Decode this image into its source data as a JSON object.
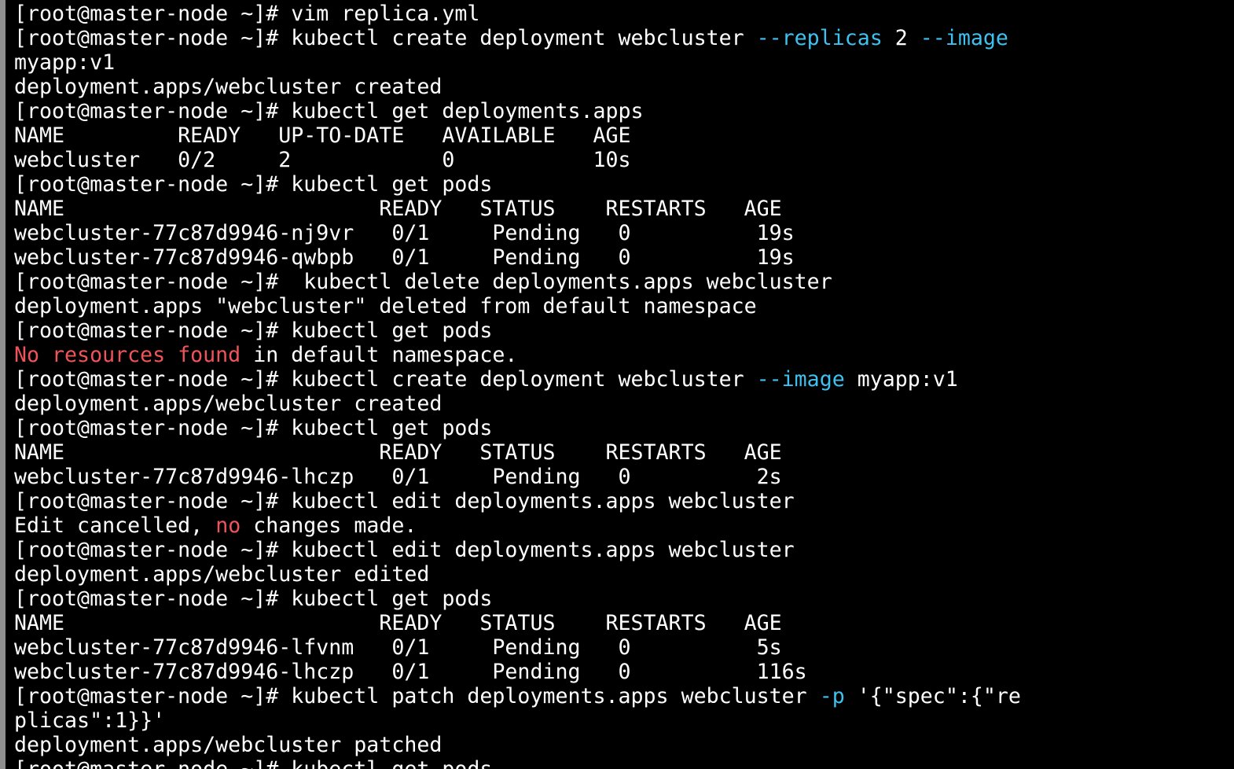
{
  "colors": {
    "background": "#000000",
    "text": "#ffffff",
    "option": "#3fc1f0",
    "error": "#f0545b"
  },
  "terminal": {
    "lines": [
      [
        {
          "t": "[root@master-node ~]# vim replica.yml"
        }
      ],
      [
        {
          "t": "[root@master-node ~]# kubectl create deployment webcluster "
        },
        {
          "t": "--replicas",
          "c": "cyan"
        },
        {
          "t": " 2 "
        },
        {
          "t": "--image",
          "c": "cyan"
        }
      ],
      [
        {
          "t": "myapp:v1"
        }
      ],
      [
        {
          "t": "deployment.apps/webcluster created"
        }
      ],
      [
        {
          "t": "[root@master-node ~]# kubectl get deployments.apps"
        }
      ],
      [
        {
          "t": "NAME         READY   UP-TO-DATE   AVAILABLE   AGE"
        }
      ],
      [
        {
          "t": "webcluster   0/2     2            0           10s"
        }
      ],
      [
        {
          "t": "[root@master-node ~]# kubectl get pods"
        }
      ],
      [
        {
          "t": "NAME                         READY   STATUS    RESTARTS   AGE"
        }
      ],
      [
        {
          "t": "webcluster-77c87d9946-nj9vr   0/1     Pending   0          19s"
        }
      ],
      [
        {
          "t": "webcluster-77c87d9946-qwbpb   0/1     Pending   0          19s"
        }
      ],
      [
        {
          "t": "[root@master-node ~]#  kubectl delete deployments.apps webcluster"
        }
      ],
      [
        {
          "t": "deployment.apps \"webcluster\" deleted from default namespace"
        }
      ],
      [
        {
          "t": "[root@master-node ~]# kubectl get pods"
        }
      ],
      [
        {
          "t": "No resources found",
          "c": "red"
        },
        {
          "t": " in default namespace."
        }
      ],
      [
        {
          "t": "[root@master-node ~]# kubectl create deployment webcluster "
        },
        {
          "t": "--image",
          "c": "cyan"
        },
        {
          "t": " myapp:v1"
        }
      ],
      [
        {
          "t": "deployment.apps/webcluster created"
        }
      ],
      [
        {
          "t": "[root@master-node ~]# kubectl get pods"
        }
      ],
      [
        {
          "t": "NAME                         READY   STATUS    RESTARTS   AGE"
        }
      ],
      [
        {
          "t": "webcluster-77c87d9946-lhczp   0/1     Pending   0          2s"
        }
      ],
      [
        {
          "t": "[root@master-node ~]# kubectl edit deployments.apps webcluster"
        }
      ],
      [
        {
          "t": "Edit cancelled, "
        },
        {
          "t": "no",
          "c": "red"
        },
        {
          "t": " changes made."
        }
      ],
      [
        {
          "t": "[root@master-node ~]# kubectl edit deployments.apps webcluster"
        }
      ],
      [
        {
          "t": "deployment.apps/webcluster edited"
        }
      ],
      [
        {
          "t": "[root@master-node ~]# kubectl get pods"
        }
      ],
      [
        {
          "t": "NAME                         READY   STATUS    RESTARTS   AGE"
        }
      ],
      [
        {
          "t": "webcluster-77c87d9946-lfvnm   0/1     Pending   0          5s"
        }
      ],
      [
        {
          "t": "webcluster-77c87d9946-lhczp   0/1     Pending   0          116s"
        }
      ],
      [
        {
          "t": "[root@master-node ~]# kubectl patch deployments.apps webcluster "
        },
        {
          "t": "-p",
          "c": "cyan"
        },
        {
          "t": " '{\"spec\":{\"re"
        }
      ],
      [
        {
          "t": "plicas\":1}}'"
        }
      ],
      [
        {
          "t": "deployment.apps/webcluster patched"
        }
      ],
      [
        {
          "t": "[root@master-node ~]# kubectl get pods"
        }
      ]
    ]
  }
}
